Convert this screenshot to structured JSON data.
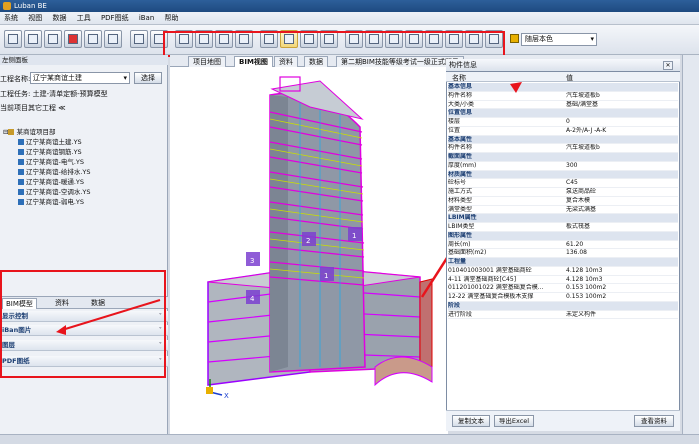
{
  "app": {
    "title": "Luban BE"
  },
  "menu": [
    "系统",
    "视图",
    "数据",
    "工具",
    "PDF图纸",
    "iBan",
    "帮助"
  ],
  "toolbar": {
    "color_label": "随层本色",
    "color_swatch": "#e8b000"
  },
  "left": {
    "panel_title": "左侧面板",
    "project_label": "工程名称:",
    "project_value": "辽宁某商谊土建",
    "select_btn": "选择",
    "task_label": "工程任务:",
    "task_value": "土建-清单定额-预算模型",
    "other_label": "当前项目其它工程 ≪",
    "tree": [
      "某商谊项目部",
      "辽宁某商谊土建.YS",
      "辽宁某商谊钢筋.YS",
      "辽宁某商谊-电气.YS",
      "辽宁某商谊-给排水.YS",
      "辽宁某商谊-暖通.YS",
      "辽宁某商谊-空调水.YS",
      "辽宁某商谊-弱电.YS"
    ],
    "tabs": [
      "BIM模型",
      "资料",
      "数据"
    ],
    "rows": [
      "显示控制",
      "iBan图片",
      "图层",
      "PDF图纸"
    ]
  },
  "viewtabs": [
    "项目地图",
    "BIM视图",
    "资料",
    "数据",
    "第二期BIM技能等级考试一级正式题目"
  ],
  "floor_labels": [
    "2",
    "1",
    "1",
    "3",
    "4"
  ],
  "prop": {
    "title": "构件信息",
    "col_name": "名称",
    "col_value": "值",
    "rows": [
      {
        "s": 1,
        "n": "基本信息",
        "v": ""
      },
      {
        "s": 0,
        "n": "构件名称",
        "v": "汽车坡道板b"
      },
      {
        "s": 0,
        "n": "大类/小类",
        "v": "基础/满堂基"
      },
      {
        "s": 1,
        "n": "位置信息",
        "v": ""
      },
      {
        "s": 0,
        "n": "楼层",
        "v": "0"
      },
      {
        "s": 0,
        "n": "位置",
        "v": "A-2外/A-J -A-K"
      },
      {
        "s": 1,
        "n": "基本属性",
        "v": ""
      },
      {
        "s": 0,
        "n": "构件名称",
        "v": "汽车坡道板b"
      },
      {
        "s": 1,
        "n": "截面属性",
        "v": ""
      },
      {
        "s": 0,
        "n": "厚度(mm)",
        "v": "300"
      },
      {
        "s": 1,
        "n": "材质属性",
        "v": ""
      },
      {
        "s": 0,
        "n": "砼标号",
        "v": "C45"
      },
      {
        "s": 0,
        "n": "施工方式",
        "v": "泵送商品砼"
      },
      {
        "s": 0,
        "n": "材料类型",
        "v": "复合木模"
      },
      {
        "s": 0,
        "n": "满堂类型",
        "v": "无梁式满基"
      },
      {
        "s": 1,
        "n": "LBIM属性",
        "v": ""
      },
      {
        "s": 0,
        "n": "LBIM类型",
        "v": "板式筏基"
      },
      {
        "s": 1,
        "n": "图形属性",
        "v": ""
      },
      {
        "s": 0,
        "n": "周长(m)",
        "v": "61.20"
      },
      {
        "s": 0,
        "n": "基础面积(m2)",
        "v": "136.08"
      },
      {
        "s": 1,
        "n": "工程量",
        "v": ""
      },
      {
        "s": 0,
        "n": "010401003001  满堂基础商砼",
        "v": "4.128 10m3"
      },
      {
        "s": 0,
        "n": "4-11  满堂基础商砼[C45]",
        "v": "4.128 10m3"
      },
      {
        "s": 0,
        "n": "011201001022  满堂基础复合模...",
        "v": "0.153 100m2"
      },
      {
        "s": 0,
        "n": "12-22  满堂基础复合模板木支撑",
        "v": "0.153 100m2"
      },
      {
        "s": 1,
        "n": "阶段",
        "v": ""
      },
      {
        "s": 0,
        "n": "进行阶段",
        "v": "未定义构件"
      }
    ],
    "btn_export_text": "复制文本",
    "btn_export_excel": "导出Excel",
    "btn_view": "查看资料"
  }
}
